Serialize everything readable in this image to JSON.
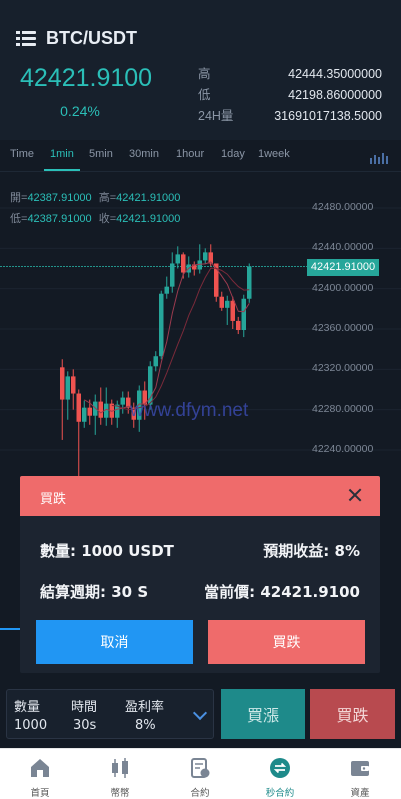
{
  "header": {
    "pair": "BTC/USDT",
    "price": "42421.9100",
    "change": "0.24%",
    "stats": [
      {
        "label": "高",
        "value": "42444.35000000"
      },
      {
        "label": "低",
        "value": "42198.86000000"
      },
      {
        "label": "24H量",
        "value": "31691017138.5000"
      }
    ]
  },
  "tabs": [
    "Time",
    "1min",
    "5min",
    "30min",
    "1hour",
    "1day",
    "1week"
  ],
  "active_tab": "1min",
  "ohlc": {
    "open_label": "開=",
    "open": "42387.91000",
    "high_label": "高=",
    "high": "42421.91000",
    "low_label": "低=",
    "low": "42387.91000",
    "close_label": "收=",
    "close": "42421.91000"
  },
  "chart_data": {
    "type": "candlestick",
    "y_axis_ticks": [
      "42480.00000",
      "42440.00000",
      "42400.00000",
      "42360.00000",
      "42320.00000",
      "42280.00000",
      "42240.00000"
    ],
    "current_price_label": "42421.91000",
    "candles": [
      {
        "o": 42322,
        "c": 42290,
        "h": 42330,
        "l": 42250
      },
      {
        "o": 42290,
        "c": 42313,
        "h": 42318,
        "l": 42270
      },
      {
        "o": 42313,
        "c": 42296,
        "h": 42320,
        "l": 42280
      },
      {
        "o": 42296,
        "c": 42268,
        "h": 42300,
        "l": 42208
      },
      {
        "o": 42268,
        "c": 42282,
        "h": 42289,
        "l": 42262
      },
      {
        "o": 42282,
        "c": 42274,
        "h": 42290,
        "l": 42265
      },
      {
        "o": 42274,
        "c": 42288,
        "h": 42295,
        "l": 42255
      },
      {
        "o": 42288,
        "c": 42272,
        "h": 42302,
        "l": 42265
      },
      {
        "o": 42272,
        "c": 42286,
        "h": 42302,
        "l": 42264
      },
      {
        "o": 42286,
        "c": 42272,
        "h": 42290,
        "l": 42265
      },
      {
        "o": 42272,
        "c": 42285,
        "h": 42289,
        "l": 42262
      },
      {
        "o": 42285,
        "c": 42292,
        "h": 42298,
        "l": 42276
      },
      {
        "o": 42292,
        "c": 42282,
        "h": 42298,
        "l": 42276
      },
      {
        "o": 42282,
        "c": 42270,
        "h": 42287,
        "l": 42262
      },
      {
        "o": 42270,
        "c": 42299,
        "h": 42304,
        "l": 42258
      },
      {
        "o": 42299,
        "c": 42285,
        "h": 42308,
        "l": 42270
      },
      {
        "o": 42285,
        "c": 42323,
        "h": 42328,
        "l": 42280
      },
      {
        "o": 42323,
        "c": 42333,
        "h": 42338,
        "l": 42318
      },
      {
        "o": 42333,
        "c": 42395,
        "h": 42398,
        "l": 42330
      },
      {
        "o": 42395,
        "c": 42402,
        "h": 42412,
        "l": 42390
      },
      {
        "o": 42402,
        "c": 42425,
        "h": 42436,
        "l": 42396
      },
      {
        "o": 42425,
        "c": 42434,
        "h": 42442,
        "l": 42420
      },
      {
        "o": 42434,
        "c": 42416,
        "h": 42436,
        "l": 42410
      },
      {
        "o": 42416,
        "c": 42424,
        "h": 42432,
        "l": 42411
      },
      {
        "o": 42424,
        "c": 42419,
        "h": 42427,
        "l": 42413
      },
      {
        "o": 42419,
        "c": 42428,
        "h": 42444,
        "l": 42415
      },
      {
        "o": 42428,
        "c": 42436,
        "h": 42440,
        "l": 42425
      },
      {
        "o": 42436,
        "c": 42425,
        "h": 42444,
        "l": 42422
      },
      {
        "o": 42425,
        "c": 42392,
        "h": 42404,
        "l": 42387
      },
      {
        "o": 42392,
        "c": 42381,
        "h": 42397,
        "l": 42378
      },
      {
        "o": 42381,
        "c": 42388,
        "h": 42393,
        "l": 42364
      },
      {
        "o": 42388,
        "c": 42368,
        "h": 42392,
        "l": 42360
      },
      {
        "o": 42368,
        "c": 42359,
        "h": 42372,
        "l": 42355
      },
      {
        "o": 42359,
        "c": 42390,
        "h": 42394,
        "l": 42352
      },
      {
        "o": 42390,
        "c": 42422,
        "h": 42425,
        "l": 42386
      }
    ],
    "y_min": 42200,
    "y_max": 42500
  },
  "watermark": "www.dfym.net",
  "dialog": {
    "title": "買跌",
    "quantity_label": "數量:",
    "quantity_value": "1000 USDT",
    "expected_label": "預期收益:",
    "expected_value": "8%",
    "period_label": "結算週期:",
    "period_value": "30 S",
    "current_label": "當前價:",
    "current_value": "42421.9100",
    "cancel": "取消",
    "confirm": "買跌"
  },
  "order": {
    "qty_label": "數量",
    "qty_value": "1000",
    "time_label": "時間",
    "time_value": "30s",
    "rate_label": "盈利率",
    "rate_value": "8%",
    "buy_up": "買漲",
    "buy_down": "買跌"
  },
  "nav": [
    {
      "label": "首頁",
      "icon": "home-icon"
    },
    {
      "label": "幣幣",
      "icon": "candles-icon"
    },
    {
      "label": "合約",
      "icon": "contract-icon"
    },
    {
      "label": "秒合約",
      "icon": "swap-icon"
    },
    {
      "label": "資產",
      "icon": "wallet-icon"
    }
  ],
  "colors": {
    "up": "#26a69a",
    "down": "#ef5350",
    "accent": "#2bbfb8",
    "dialog_header": "#ef6b6b",
    "cancel_button": "#2196f3"
  }
}
